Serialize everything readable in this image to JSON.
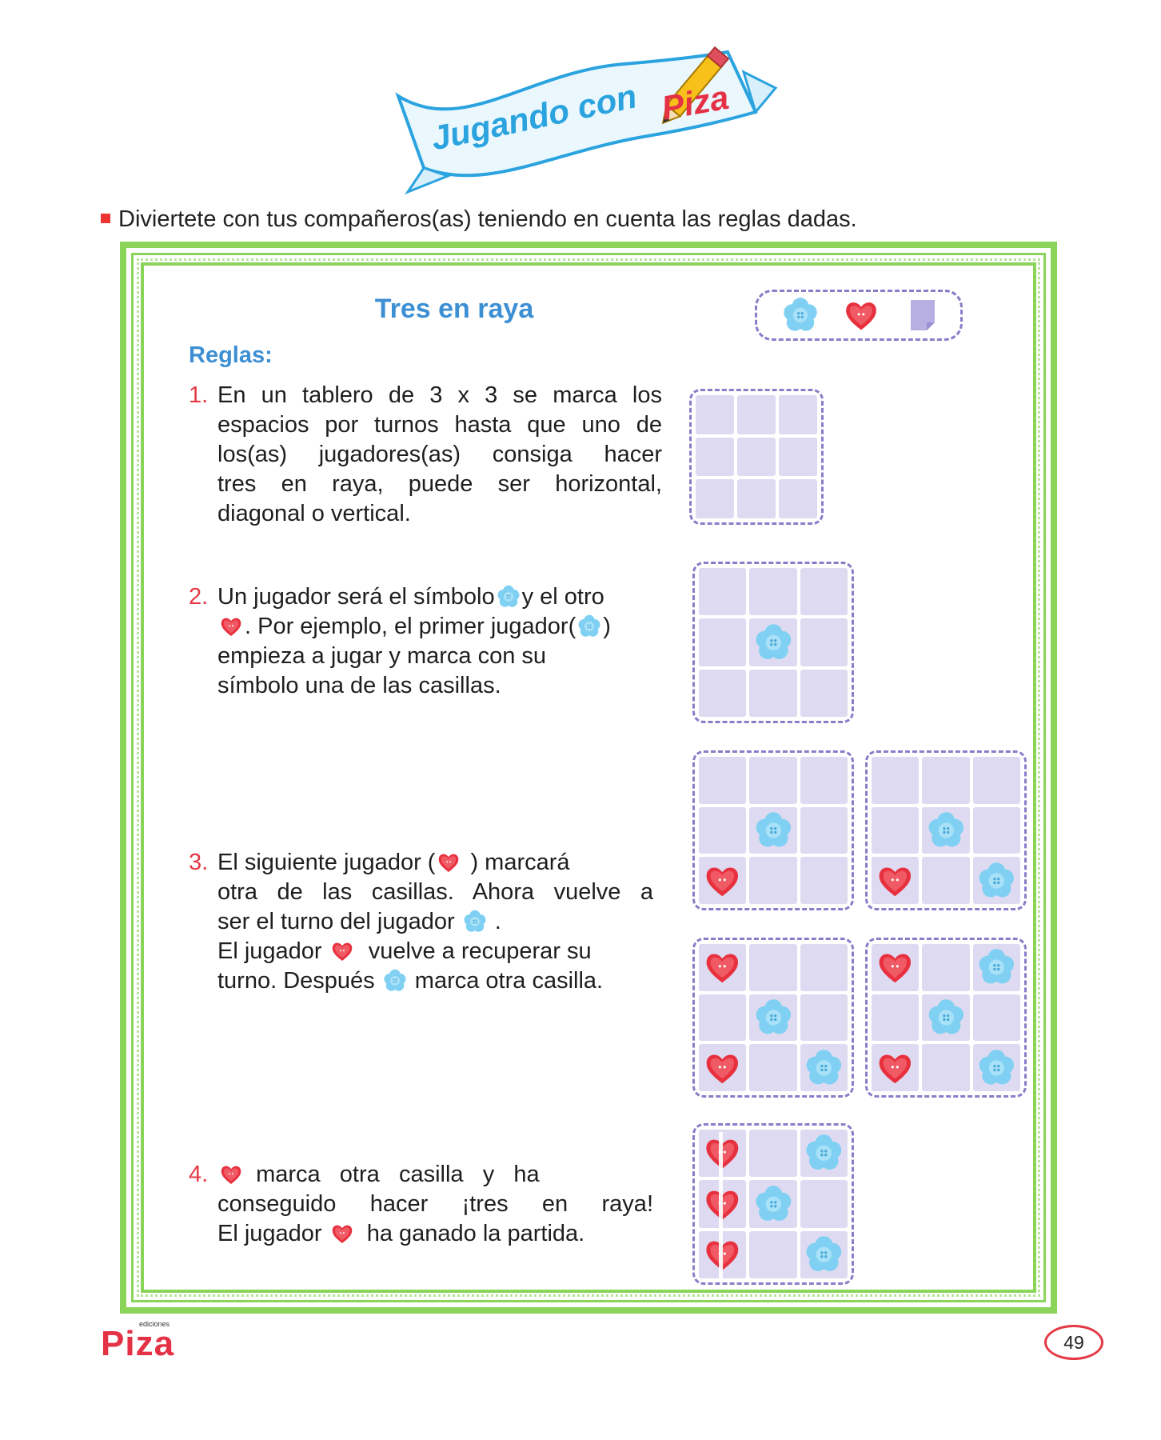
{
  "header": {
    "banner_blue": "Jugando con",
    "banner_red": "Piza"
  },
  "instruction": "Diviertete con tus compañeros(as) teniendo en cuenta las reglas dadas.",
  "activity": {
    "title": "Tres en raya",
    "rules_heading": "Reglas:",
    "legend_icons": [
      "blue-flower-icon",
      "red-heart-icon",
      "purple-sticky-note-icon"
    ],
    "rules": [
      {
        "number": "1.",
        "lines": [
          "En un tablero de 3 x 3 se marca los",
          "espacios por turnos hasta que uno de",
          "los(as) jugadores(as) consiga hacer",
          "tres en raya, puede ser horizontal,",
          "diagonal o vertical."
        ]
      },
      {
        "number": "2.",
        "l1a": "Un jugador será el símbolo",
        "l1b": "y el otro",
        "l2a": ". Por ejemplo, el primer jugador(",
        "l2b": ")",
        "l3": "empieza a jugar y marca con su",
        "l4": "símbolo una de las casillas."
      },
      {
        "number": "3.",
        "l1a": "El siguiente jugador (",
        "l1b": ")  marcará",
        "l2": "otra de las casillas. Ahora vuelve a",
        "l3a": "ser el turno del jugador",
        "l3b": ".",
        "l4a": "El jugador",
        "l4b": "vuelve a recuperar su",
        "l5a": "turno. Después",
        "l5b": "marca otra casilla."
      },
      {
        "number": "4.",
        "l1a": "marca   otra   casilla   y   ha",
        "l2": "conseguido hacer ¡tres en raya!",
        "l3a": "El jugador",
        "l3b": "ha ganado la partida."
      }
    ],
    "boards": [
      {
        "cells": [
          "",
          "",
          "",
          "",
          "",
          "",
          "",
          "",
          ""
        ]
      },
      {
        "cells": [
          "",
          "",
          "",
          "",
          "F",
          "",
          "",
          "",
          ""
        ]
      },
      {
        "cells": [
          "",
          "",
          "",
          "",
          "F",
          "",
          "H",
          "",
          ""
        ]
      },
      {
        "cells": [
          "",
          "",
          "",
          "",
          "F",
          "",
          "H",
          "",
          "F"
        ]
      },
      {
        "cells": [
          "H",
          "",
          "",
          "",
          "F",
          "",
          "H",
          "",
          "F"
        ]
      },
      {
        "cells": [
          "H",
          "",
          "F",
          "",
          "F",
          "",
          "H",
          "",
          "F"
        ]
      },
      {
        "cells": [
          "H",
          "",
          "F",
          "H",
          "F",
          "",
          "H",
          "",
          "F"
        ]
      }
    ]
  },
  "footer": {
    "logo_small": "ediciones",
    "logo": "Piza",
    "page_number": "49"
  },
  "colors": {
    "frame_green": "#8bd45a",
    "title_blue": "#3d8fd4",
    "number_red": "#e33a46",
    "cell_lavender": "#dedaf1",
    "dash_purple": "#8a7cc8"
  }
}
